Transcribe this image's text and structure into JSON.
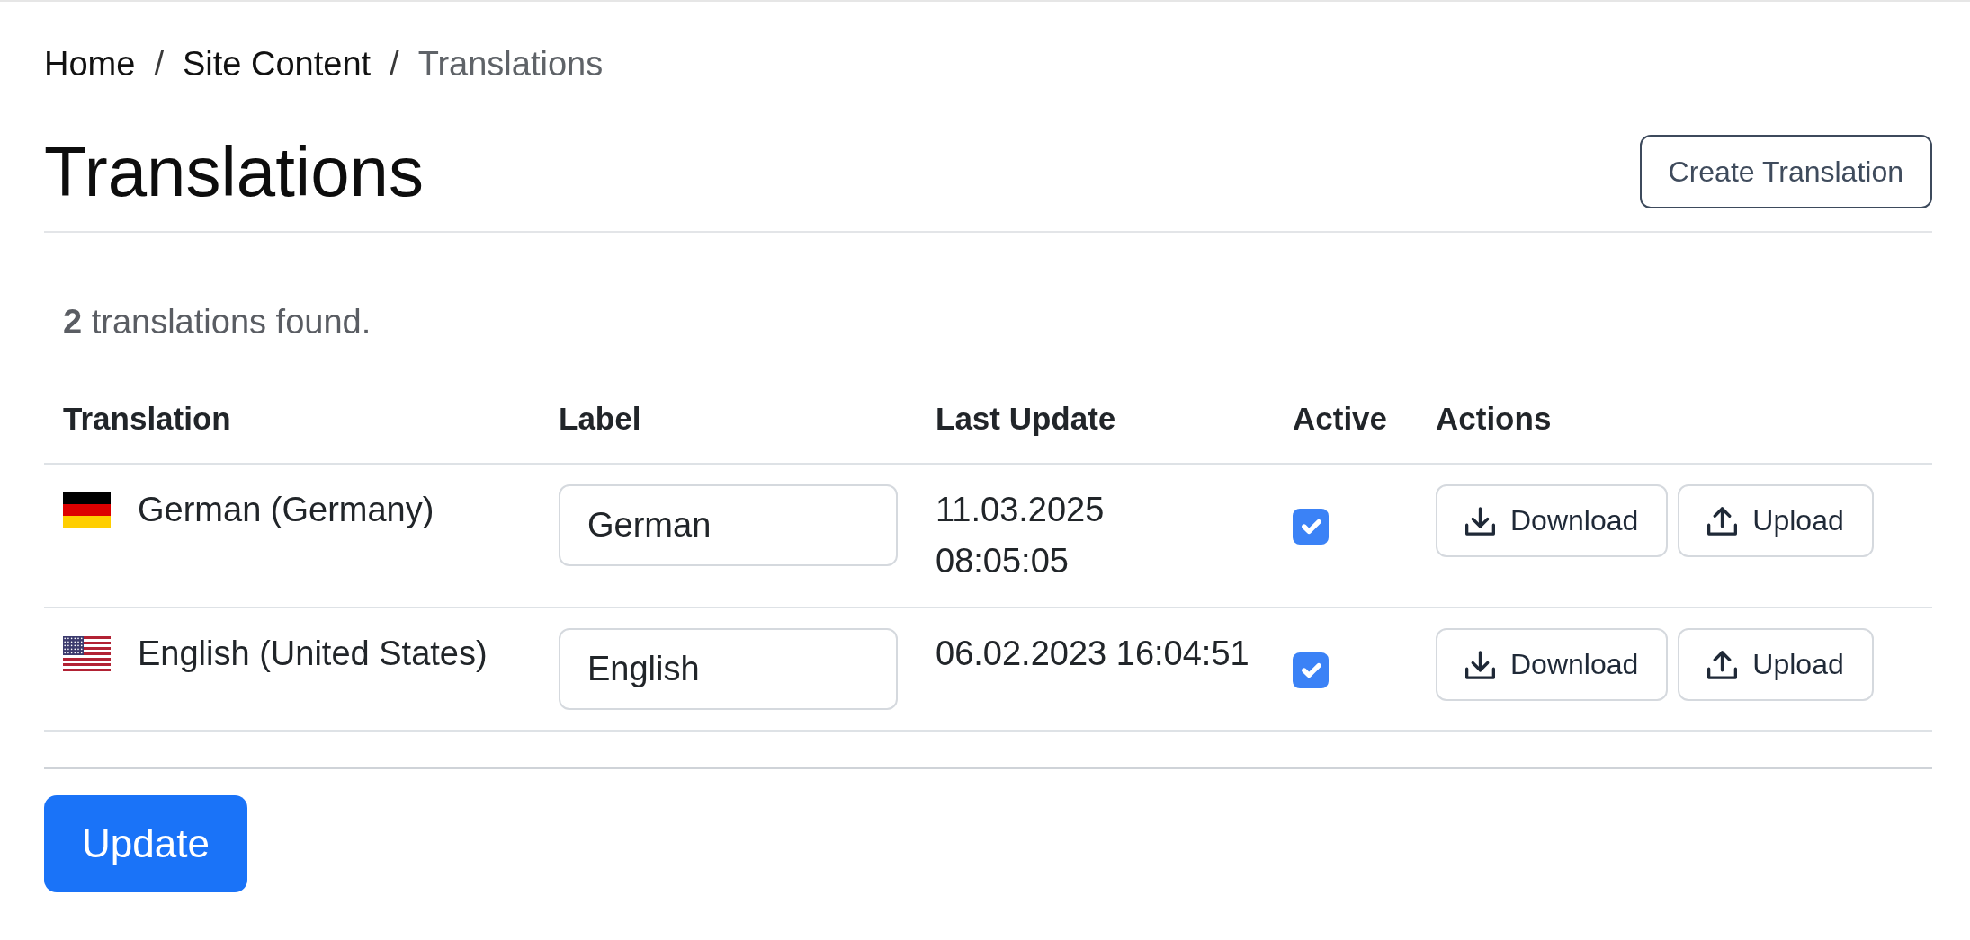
{
  "breadcrumb": [
    {
      "label": "Home",
      "current": false,
      "separator": "/"
    },
    {
      "label": "Site Content",
      "current": false,
      "separator": "/"
    },
    {
      "label": "Translations",
      "current": true
    }
  ],
  "header": {
    "title": "Translations",
    "create_button": "Create Translation"
  },
  "summary": "**2** translations found.",
  "table": {
    "columns": [
      "Translation",
      "Label",
      "Last Update",
      "Active",
      "Actions"
    ],
    "rows": [
      {
        "kind": "de",
        "translation": "German (Germany)",
        "label": "German",
        "last_update": "11.03.2025\n08:05:05",
        "active": true,
        "actions": [
          {
            "kind": "download",
            "label": "Download"
          },
          {
            "kind": "upload",
            "label": "Upload"
          }
        ]
      },
      {
        "kind": "us",
        "translation": "English (United States)",
        "label": "English",
        "last_update": "06.02.2023 16:04:51",
        "active": true,
        "actions": [
          {
            "kind": "download",
            "label": "Download"
          },
          {
            "kind": "upload",
            "label": "Upload"
          }
        ]
      }
    ]
  },
  "update_button": "Update"
}
